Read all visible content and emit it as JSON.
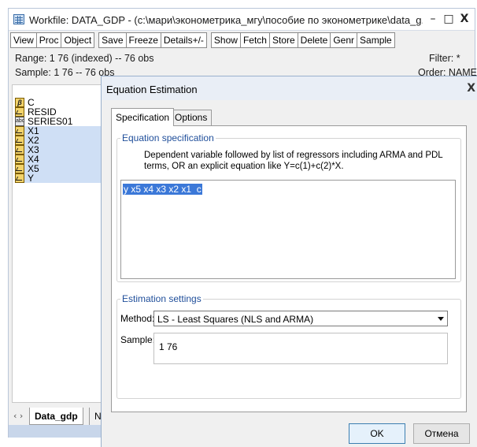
{
  "workfile": {
    "title": "Workfile: DATA_GDP - (c:\\мари\\эконометрика_мгу\\пособие по эконометрике\\data_g...",
    "controls": {
      "minimize": "–",
      "maximize": "□",
      "close": "X"
    },
    "toolbar": [
      "View",
      "Proc",
      "Object",
      "Save",
      "Freeze",
      "Details+/-",
      "Show",
      "Fetch",
      "Store",
      "Delete",
      "Genr",
      "Sample"
    ],
    "range_text": "Range:  1 76 (indexed)  --  76 obs",
    "filter_text": "Filter: *",
    "sample_text": "Sample: 1 76  --  76 obs",
    "order_text": "Order: NAME",
    "objects": [
      {
        "name": "C",
        "icon": "coefficient-icon",
        "selected": false
      },
      {
        "name": "RESID",
        "icon": "series-icon",
        "selected": false
      },
      {
        "name": "SERIES01",
        "icon": "alpha-icon",
        "selected": false
      },
      {
        "name": "X1",
        "icon": "series-icon",
        "selected": true
      },
      {
        "name": "X2",
        "icon": "series-icon",
        "selected": true
      },
      {
        "name": "X3",
        "icon": "series-icon",
        "selected": true
      },
      {
        "name": "X4",
        "icon": "series-icon",
        "selected": true
      },
      {
        "name": "X5",
        "icon": "series-icon",
        "selected": true
      },
      {
        "name": "Y",
        "icon": "series-icon",
        "selected": true
      }
    ],
    "tab_nav": "‹ ›",
    "tabs": [
      "Data_gdp",
      "N"
    ]
  },
  "dialog": {
    "title": "Equation Estimation",
    "close": "X",
    "tabs": [
      "Specification",
      "Options"
    ],
    "spec_group_label": "Equation specification",
    "spec_description": "Dependent variable followed by list of regressors including ARMA and PDL terms, OR an explicit equation like Y=c(1)+c(2)*X.",
    "spec_value": "y x5 x4 x3 x2 x1  c",
    "est_group_label": "Estimation settings",
    "method_label": "Method:",
    "method_value": "LS  -  Least Squares (NLS and ARMA)",
    "sample_label": "Sample:",
    "sample_value": "1 76",
    "ok_label": "OK",
    "cancel_label": "Отмена"
  }
}
